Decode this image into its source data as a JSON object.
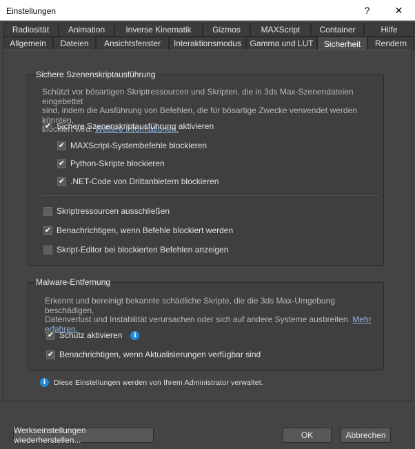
{
  "window": {
    "title": "Einstellungen",
    "help_glyph": "?",
    "close_glyph": "✕"
  },
  "tabs_row1": [
    "Radiosität",
    "Animation",
    "Inverse Kinematik",
    "Gizmos",
    "MAXScript",
    "Container",
    "Hilfe"
  ],
  "tabs_row2": [
    "Allgemein",
    "Dateien",
    "Ansichtsfenster",
    "Interaktionsmodus",
    "Gamma und LUT",
    "Sicherheit",
    "Rendern"
  ],
  "active_tab": "Sicherheit",
  "secure_group": {
    "title": "Sichere Szenenskriptausführung",
    "description_line1": "Schützt vor bösartigen Skriptressourcen und Skripten, die in 3ds Max-Szenendateien eingebettet",
    "description_line2": "sind, indem die Ausführung von Befehlen, die für bösartige Zwecke verwendet werden könnten,",
    "description_line3": "blockiert wird.",
    "link": "Weitere Informationen.",
    "enable": {
      "label": "Sichere Szenenskriptausführung aktivieren",
      "checked": true
    },
    "maxscript": {
      "label": "MAXScript-Systembefehle blockieren",
      "checked": true
    },
    "python": {
      "label": "Python-Skripte blockieren",
      "checked": true
    },
    "dotnet": {
      "label": ".NET-Code von Drittanbietern blockieren",
      "checked": true
    },
    "exclude": {
      "label": "Skriptressourcen ausschließen",
      "checked": false
    },
    "notify": {
      "label": "Benachrichtigen, wenn Befehle blockiert werden",
      "checked": true
    },
    "editor": {
      "label": "Skript-Editor bei blockierten Befehlen anzeigen",
      "checked": false
    }
  },
  "malware_group": {
    "title": "Malware-Entfernung",
    "description_line1": "Erkennt und bereinigt bekannte schädliche Skripte, die die 3ds Max-Umgebung beschädigen,",
    "description_line2": "Datenverlust und Instabilität verursachen oder sich auf andere Systeme ausbreiten.",
    "link_part1": "Mehr",
    "link_part2": "erfahren.",
    "protect": {
      "label": "Schutz aktivieren",
      "checked": true
    },
    "updates": {
      "label": "Benachrichtigen, wenn Aktualisierungen verfügbar sind",
      "checked": true
    }
  },
  "admin_note": "Diese Einstellungen werden von Ihrem Administrator verwaltet.",
  "check_glyph": "✔",
  "info_glyph": "i",
  "buttons": {
    "reset": "Werkseinstellungen wiederherstellen...",
    "ok": "OK",
    "cancel": "Abbrechen"
  },
  "colors": {
    "background": "#444444",
    "link": "#8fb4e0",
    "info": "#1e8bdc"
  }
}
